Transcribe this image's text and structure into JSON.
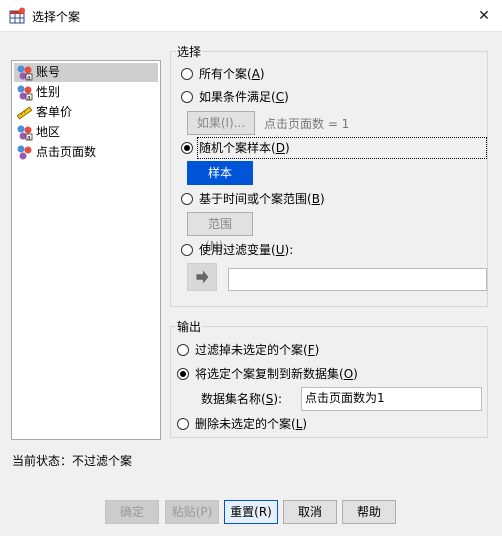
{
  "window": {
    "title": "选择个案"
  },
  "variables": [
    {
      "label": "账号",
      "icon": "nominal-variable-icon",
      "selected": true
    },
    {
      "label": "性别",
      "icon": "nominal-variable-icon",
      "selected": false
    },
    {
      "label": "客单价",
      "icon": "scale-variable-icon",
      "selected": false
    },
    {
      "label": "地区",
      "icon": "nominal-variable-icon",
      "selected": false
    },
    {
      "label": "点击页面数",
      "icon": "ordinal-variable-icon",
      "selected": false
    }
  ],
  "select": {
    "title": "选择",
    "all_cases": "所有个案",
    "all_cases_key": "A",
    "if_condition": "如果条件满足",
    "if_condition_key": "C",
    "if_button": "如果(I)...",
    "if_hint": "点击页面数 = 1",
    "random_sample": "随机个案样本",
    "random_sample_key": "D",
    "sample_button": "样本(S)...",
    "time_range": "基于时间或个案范围",
    "time_range_key": "B",
    "range_button": "范围(N)...",
    "filter_var": "使用过滤变量",
    "filter_var_key": "U",
    "filter_var_suffix": ":",
    "filter_value": "",
    "selected_option": "random_sample"
  },
  "output": {
    "title": "输出",
    "filter_out": "过滤掉未选定的个案",
    "filter_out_key": "F",
    "copy_new": "将选定个案复制到新数据集",
    "copy_new_key": "O",
    "dataset_name_label": "数据集名称",
    "dataset_name_key": "S",
    "dataset_name_suffix": ":",
    "dataset_name_value": "点击页面数为1",
    "delete": "删除未选定的个案",
    "delete_key": "L",
    "selected_option": "copy_new"
  },
  "status": {
    "text": "当前状态：不过滤个案"
  },
  "buttons": {
    "ok": "确定",
    "paste": "粘贴(P)",
    "reset": "重置(R)",
    "cancel": "取消",
    "help": "帮助"
  },
  "colors": {
    "accent": "#0054d6",
    "selection": "#cfcfcf"
  }
}
